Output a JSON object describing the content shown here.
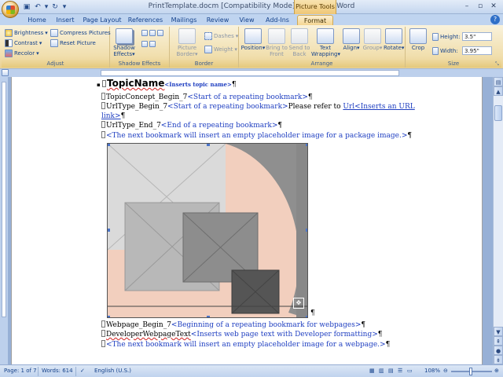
{
  "window": {
    "title": "PrintTemplate.docm [Compatibility Mode] - Microsoft Word",
    "context_tab_group": "Picture Tools"
  },
  "tabs": [
    {
      "label": "Home"
    },
    {
      "label": "Insert"
    },
    {
      "label": "Page Layout"
    },
    {
      "label": "References"
    },
    {
      "label": "Mailings"
    },
    {
      "label": "Review"
    },
    {
      "label": "View"
    },
    {
      "label": "Add-Ins"
    },
    {
      "label": "Format",
      "active": true
    }
  ],
  "ribbon": {
    "adjust": {
      "label": "Adjust",
      "brightness": "Brightness",
      "contrast": "Contrast",
      "recolor": "Recolor",
      "compress": "Compress Pictures",
      "reset": "Reset Picture"
    },
    "shadow": {
      "label": "Shadow Effects",
      "button": "Shadow Effects"
    },
    "border": {
      "label": "Border",
      "picture_border": "Picture Border",
      "dashes": "Dashes",
      "weight": "Weight"
    },
    "arrange": {
      "label": "Arrange",
      "position": "Position",
      "bring_to_front": "Bring to Front",
      "send_to_back": "Send to Back",
      "text_wrapping": "Text Wrapping",
      "align": "Align",
      "group": "Group",
      "rotate": "Rotate"
    },
    "size": {
      "label": "Size",
      "crop": "Crop",
      "height_label": "Height:",
      "height_value": "3.5\"",
      "width_label": "Width:",
      "width_value": "3.95\""
    }
  },
  "document": {
    "topic_name": "TopicName",
    "topic_bookmark": "<Inserts topic name>",
    "line1_text": "TopicConcept_Begin_7",
    "line1_bm": "<Start of a repeating bookmark>",
    "line2_text": "UrlType_Begin_7",
    "line2_bm": "<Start of a repeating bookmark>",
    "line2_tail": "Please refer to ",
    "line2_link": "Url<Inserts an URL",
    "line2_wrap": "link>",
    "line3_text": "UrlType_End_7",
    "line3_bm": "<End of a repeating bookmark>",
    "line4_bm": "<The next bookmark will insert an empty placeholder image for a package image.>",
    "line5_text": "Webpage_Begin_7",
    "line5_bm": "<Beginning of a repeating bookmark for webpages>",
    "line6_text": "DeveloperWebpageText",
    "line6_bm": "<Inserts web page text with Developer formatting>",
    "line7_bm": "<The next bookmark will insert an empty placeholder image for a webpage.>"
  },
  "status": {
    "page": "Page: 1 of 7",
    "words": "Words: 614",
    "language": "English (U.S.)",
    "zoom": "108%"
  },
  "colors": {
    "ribbon_bg": "#f1dfae",
    "tab_bar": "#bfd4f0",
    "bookmark_text": "#1f3fc1",
    "picture_pink": "#f2cfbe"
  }
}
